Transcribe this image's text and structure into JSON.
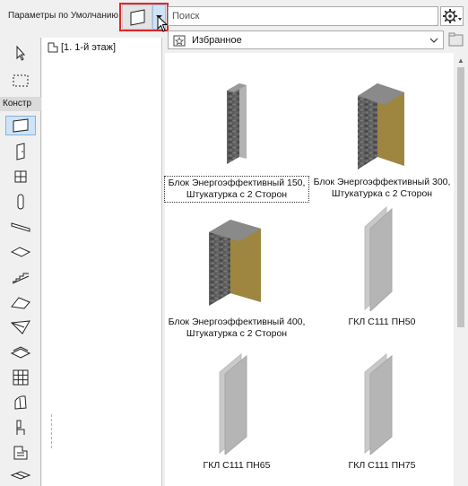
{
  "topbar": {
    "defaults_label": "Параметры по Умолчанию",
    "search_placeholder": "Поиск"
  },
  "favorites": {
    "selected": "Избранное"
  },
  "toolbox": {
    "section_label": "Констр"
  },
  "navigator": {
    "story_label": "[1. 1-й этаж]"
  },
  "gallery": {
    "items": [
      {
        "label": "Блок Энергоэффективный 150, Штукатурка с 2 Сторон",
        "kind": "wall-thin"
      },
      {
        "label": "Блок Энергоэффективный 300, Штукатурка с 2 Сторон",
        "kind": "wall-thick"
      },
      {
        "label": "Блок Энергоэффективный 400, Штукатурка с 2 Сторон",
        "kind": "wall-thicker"
      },
      {
        "label": "ГКЛ С111 ПН50",
        "kind": "gypsum"
      },
      {
        "label": "ГКЛ С111 ПН65",
        "kind": "gypsum"
      },
      {
        "label": "ГКЛ С111 ПН75",
        "kind": "gypsum"
      }
    ]
  },
  "colors": {
    "highlight_red": "#e0262b",
    "selection_blue": "#cfe3f7"
  }
}
